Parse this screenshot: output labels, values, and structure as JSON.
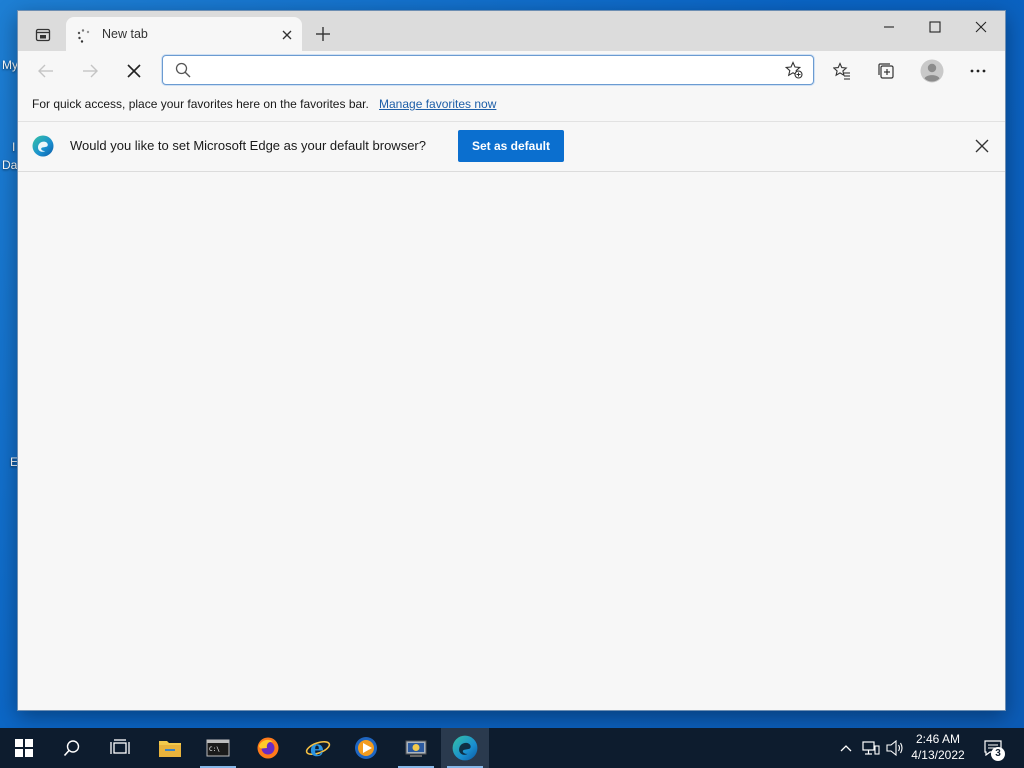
{
  "desktop": {
    "labels": [
      "My",
      "I",
      "Da",
      "E"
    ]
  },
  "browser": {
    "tab": {
      "title": "New tab"
    },
    "address": {
      "value": "",
      "placeholder": ""
    },
    "favorites_bar": {
      "message": "For quick access, place your favorites here on the favorites bar.",
      "link": "Manage favorites now"
    },
    "infobar": {
      "message": "Would you like to set Microsoft Edge as your default browser?",
      "button": "Set as default"
    }
  },
  "taskbar": {
    "apps": [
      "start",
      "search",
      "task-view",
      "file-explorer",
      "terminal",
      "firefox",
      "internet-explorer",
      "media-player",
      "network-tool",
      "edge"
    ],
    "clock": {
      "time": "2:46 AM",
      "date": "4/13/2022"
    },
    "notification_count": "3"
  },
  "colors": {
    "accent": "#0b6fcf",
    "link": "#1e5fa8",
    "taskbar": "#0d1c2e",
    "desktop": "#0a64c4"
  }
}
